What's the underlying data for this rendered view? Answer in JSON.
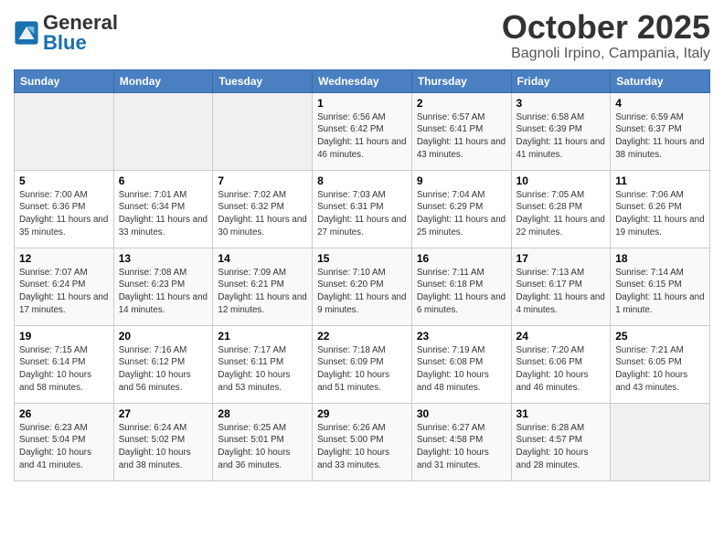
{
  "logo": {
    "text_general": "General",
    "text_blue": "Blue"
  },
  "title": "October 2025",
  "location": "Bagnoli Irpino, Campania, Italy",
  "days_header": [
    "Sunday",
    "Monday",
    "Tuesday",
    "Wednesday",
    "Thursday",
    "Friday",
    "Saturday"
  ],
  "weeks": [
    [
      {
        "date": "",
        "info": ""
      },
      {
        "date": "",
        "info": ""
      },
      {
        "date": "",
        "info": ""
      },
      {
        "date": "1",
        "info": "Sunrise: 6:56 AM\nSunset: 6:42 PM\nDaylight: 11 hours and 46 minutes."
      },
      {
        "date": "2",
        "info": "Sunrise: 6:57 AM\nSunset: 6:41 PM\nDaylight: 11 hours and 43 minutes."
      },
      {
        "date": "3",
        "info": "Sunrise: 6:58 AM\nSunset: 6:39 PM\nDaylight: 11 hours and 41 minutes."
      },
      {
        "date": "4",
        "info": "Sunrise: 6:59 AM\nSunset: 6:37 PM\nDaylight: 11 hours and 38 minutes."
      }
    ],
    [
      {
        "date": "5",
        "info": "Sunrise: 7:00 AM\nSunset: 6:36 PM\nDaylight: 11 hours and 35 minutes."
      },
      {
        "date": "6",
        "info": "Sunrise: 7:01 AM\nSunset: 6:34 PM\nDaylight: 11 hours and 33 minutes."
      },
      {
        "date": "7",
        "info": "Sunrise: 7:02 AM\nSunset: 6:32 PM\nDaylight: 11 hours and 30 minutes."
      },
      {
        "date": "8",
        "info": "Sunrise: 7:03 AM\nSunset: 6:31 PM\nDaylight: 11 hours and 27 minutes."
      },
      {
        "date": "9",
        "info": "Sunrise: 7:04 AM\nSunset: 6:29 PM\nDaylight: 11 hours and 25 minutes."
      },
      {
        "date": "10",
        "info": "Sunrise: 7:05 AM\nSunset: 6:28 PM\nDaylight: 11 hours and 22 minutes."
      },
      {
        "date": "11",
        "info": "Sunrise: 7:06 AM\nSunset: 6:26 PM\nDaylight: 11 hours and 19 minutes."
      }
    ],
    [
      {
        "date": "12",
        "info": "Sunrise: 7:07 AM\nSunset: 6:24 PM\nDaylight: 11 hours and 17 minutes."
      },
      {
        "date": "13",
        "info": "Sunrise: 7:08 AM\nSunset: 6:23 PM\nDaylight: 11 hours and 14 minutes."
      },
      {
        "date": "14",
        "info": "Sunrise: 7:09 AM\nSunset: 6:21 PM\nDaylight: 11 hours and 12 minutes."
      },
      {
        "date": "15",
        "info": "Sunrise: 7:10 AM\nSunset: 6:20 PM\nDaylight: 11 hours and 9 minutes."
      },
      {
        "date": "16",
        "info": "Sunrise: 7:11 AM\nSunset: 6:18 PM\nDaylight: 11 hours and 6 minutes."
      },
      {
        "date": "17",
        "info": "Sunrise: 7:13 AM\nSunset: 6:17 PM\nDaylight: 11 hours and 4 minutes."
      },
      {
        "date": "18",
        "info": "Sunrise: 7:14 AM\nSunset: 6:15 PM\nDaylight: 11 hours and 1 minute."
      }
    ],
    [
      {
        "date": "19",
        "info": "Sunrise: 7:15 AM\nSunset: 6:14 PM\nDaylight: 10 hours and 58 minutes."
      },
      {
        "date": "20",
        "info": "Sunrise: 7:16 AM\nSunset: 6:12 PM\nDaylight: 10 hours and 56 minutes."
      },
      {
        "date": "21",
        "info": "Sunrise: 7:17 AM\nSunset: 6:11 PM\nDaylight: 10 hours and 53 minutes."
      },
      {
        "date": "22",
        "info": "Sunrise: 7:18 AM\nSunset: 6:09 PM\nDaylight: 10 hours and 51 minutes."
      },
      {
        "date": "23",
        "info": "Sunrise: 7:19 AM\nSunset: 6:08 PM\nDaylight: 10 hours and 48 minutes."
      },
      {
        "date": "24",
        "info": "Sunrise: 7:20 AM\nSunset: 6:06 PM\nDaylight: 10 hours and 46 minutes."
      },
      {
        "date": "25",
        "info": "Sunrise: 7:21 AM\nSunset: 6:05 PM\nDaylight: 10 hours and 43 minutes."
      }
    ],
    [
      {
        "date": "26",
        "info": "Sunrise: 6:23 AM\nSunset: 5:04 PM\nDaylight: 10 hours and 41 minutes."
      },
      {
        "date": "27",
        "info": "Sunrise: 6:24 AM\nSunset: 5:02 PM\nDaylight: 10 hours and 38 minutes."
      },
      {
        "date": "28",
        "info": "Sunrise: 6:25 AM\nSunset: 5:01 PM\nDaylight: 10 hours and 36 minutes."
      },
      {
        "date": "29",
        "info": "Sunrise: 6:26 AM\nSunset: 5:00 PM\nDaylight: 10 hours and 33 minutes."
      },
      {
        "date": "30",
        "info": "Sunrise: 6:27 AM\nSunset: 4:58 PM\nDaylight: 10 hours and 31 minutes."
      },
      {
        "date": "31",
        "info": "Sunrise: 6:28 AM\nSunset: 4:57 PM\nDaylight: 10 hours and 28 minutes."
      },
      {
        "date": "",
        "info": ""
      }
    ]
  ]
}
